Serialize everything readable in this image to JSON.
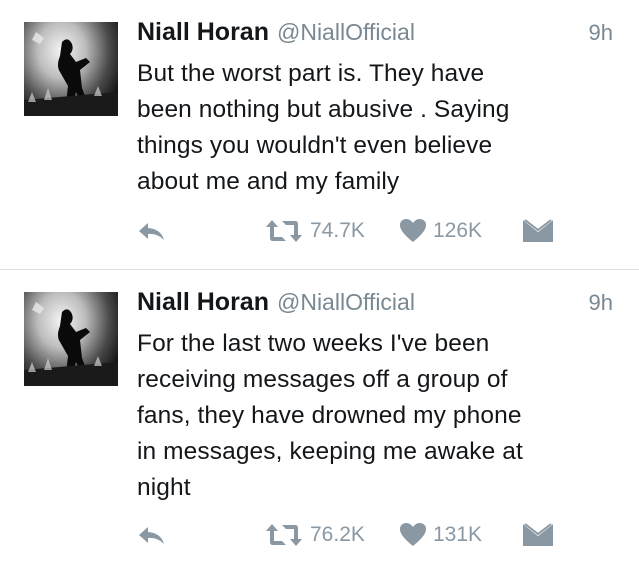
{
  "tweets": [
    {
      "author_name": "Niall Horan",
      "handle": "@NiallOfficial",
      "time": "9h",
      "lines": [
        "But the worst part is. They have",
        "been nothing but abusive . Saying",
        "things you wouldn't even believe",
        "about me and my family"
      ],
      "retweets": "74.7K",
      "likes": "126K"
    },
    {
      "author_name": "Niall Horan",
      "handle": "@NiallOfficial",
      "time": "9h",
      "lines": [
        "For the last two weeks I've been",
        "receiving messages off a group of",
        "fans, they have drowned my phone",
        "in messages, keeping me awake at",
        "night"
      ],
      "retweets": "76.2K",
      "likes": "131K"
    }
  ],
  "icons": {
    "reply": "reply-arrow-icon",
    "retweet": "retweet-icon",
    "like": "heart-icon",
    "message": "envelope-icon"
  },
  "colors": {
    "text": "#14171a",
    "muted": "#7a8892",
    "icon": "#8a98a3",
    "divider": "#d8dde2"
  }
}
